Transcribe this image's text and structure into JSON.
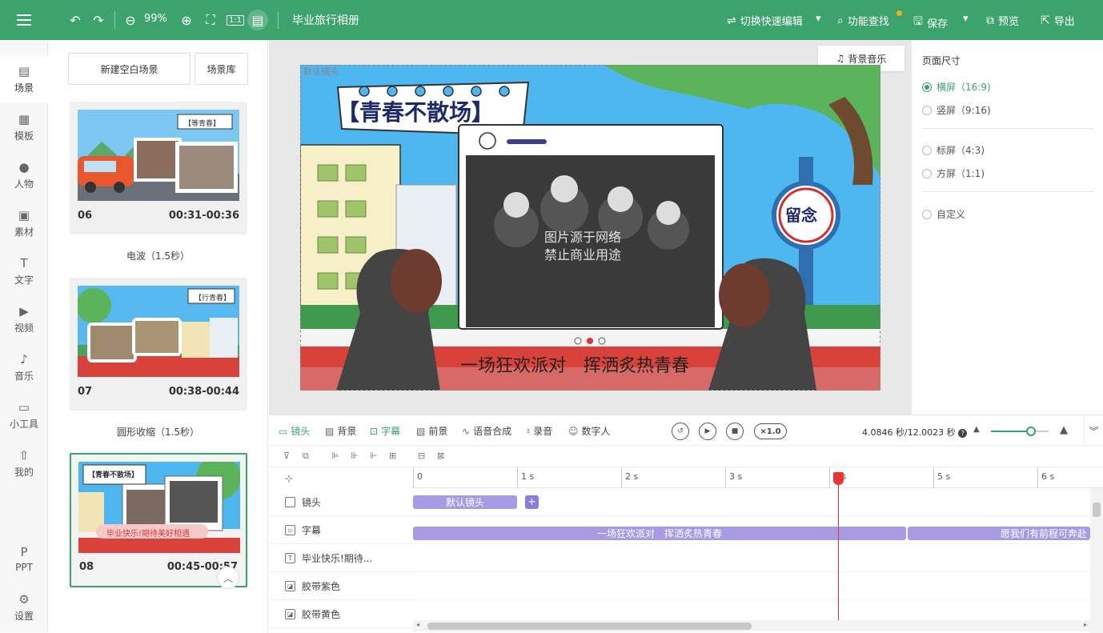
{
  "app": {
    "doc_title": "毕业旅行相册",
    "zoom": "99%",
    "actions": {
      "quick_edit": "切换快速编辑",
      "find": "功能查找",
      "save": "保存",
      "preview": "预览",
      "export": "导出"
    }
  },
  "nav": {
    "items": [
      {
        "label": "场景",
        "icon": "scene-icon"
      },
      {
        "label": "模板",
        "icon": "template-icon"
      },
      {
        "label": "人物",
        "icon": "person-icon"
      },
      {
        "label": "素材",
        "icon": "material-icon"
      },
      {
        "label": "文字",
        "icon": "text-icon"
      },
      {
        "label": "视频",
        "icon": "video-icon"
      },
      {
        "label": "音乐",
        "icon": "music-icon"
      },
      {
        "label": "小工具",
        "icon": "toolbox-icon"
      },
      {
        "label": "我的",
        "icon": "upload-icon"
      },
      {
        "label": "PPT",
        "icon": "ppt-icon"
      },
      {
        "label": "设置",
        "icon": "gear-icon"
      }
    ]
  },
  "scenes": {
    "new_blank": "新建空白场景",
    "library": "场景库",
    "list": [
      {
        "num": "06",
        "time": "00:31-00:36",
        "transition": "电波（1.5秒）",
        "tag": "【等青春】"
      },
      {
        "num": "07",
        "time": "00:38-00:44",
        "transition": "圆形收缩（1.5秒）",
        "tag": "【行青春】"
      },
      {
        "num": "08",
        "time": "00:45-00:57",
        "transition": "",
        "tag": "【青春不散场】",
        "banner": "毕业快乐!期待美好相遇"
      }
    ]
  },
  "canvas": {
    "default_camera": "默认镜头",
    "bg_music": "背景音乐",
    "title": "【青春不散场】",
    "watermark_line1": "图片源于网络",
    "watermark_line2": "禁止商业用途",
    "subtitle": "一场狂欢派对　挥洒炙热青春",
    "sign": "留念"
  },
  "page_size": {
    "title": "页面尺寸",
    "options": [
      {
        "label": "横屏（16:9)",
        "checked": true
      },
      {
        "label": "竖屏（9:16)",
        "checked": false
      },
      {
        "label": "标屏（4:3)",
        "checked": false
      },
      {
        "label": "方屏（1:1)",
        "checked": false
      },
      {
        "label": "自定义",
        "checked": false
      }
    ]
  },
  "timeline": {
    "tabs": [
      "镜头",
      "背景",
      "字幕",
      "前景",
      "语音合成",
      "录音",
      "数字人"
    ],
    "active_tab": "字幕",
    "speed": "×1.0",
    "time_readout": "4.0846 秒/12.0023 秒",
    "zoom_level": 0.7,
    "ruler": [
      "0",
      "1 s",
      "2 s",
      "3 s",
      "4 s",
      "5 s",
      "6 s"
    ],
    "tracks": [
      {
        "label": "镜头",
        "clips": [
          "默认镜头"
        ]
      },
      {
        "label": "字幕",
        "clips": [
          "一场狂欢派对　挥洒炙热青春",
          "愿我们有前程可奔赴"
        ]
      },
      {
        "label": "毕业快乐!期待...",
        "clips": []
      },
      {
        "label": "胶带紫色",
        "clips": []
      },
      {
        "label": "胶带黄色",
        "clips": []
      }
    ],
    "playhead_seconds": 4.0846
  },
  "colors": {
    "brand": "#3ca36e",
    "clip": "#a89be3",
    "playhead": "#dd3333"
  }
}
